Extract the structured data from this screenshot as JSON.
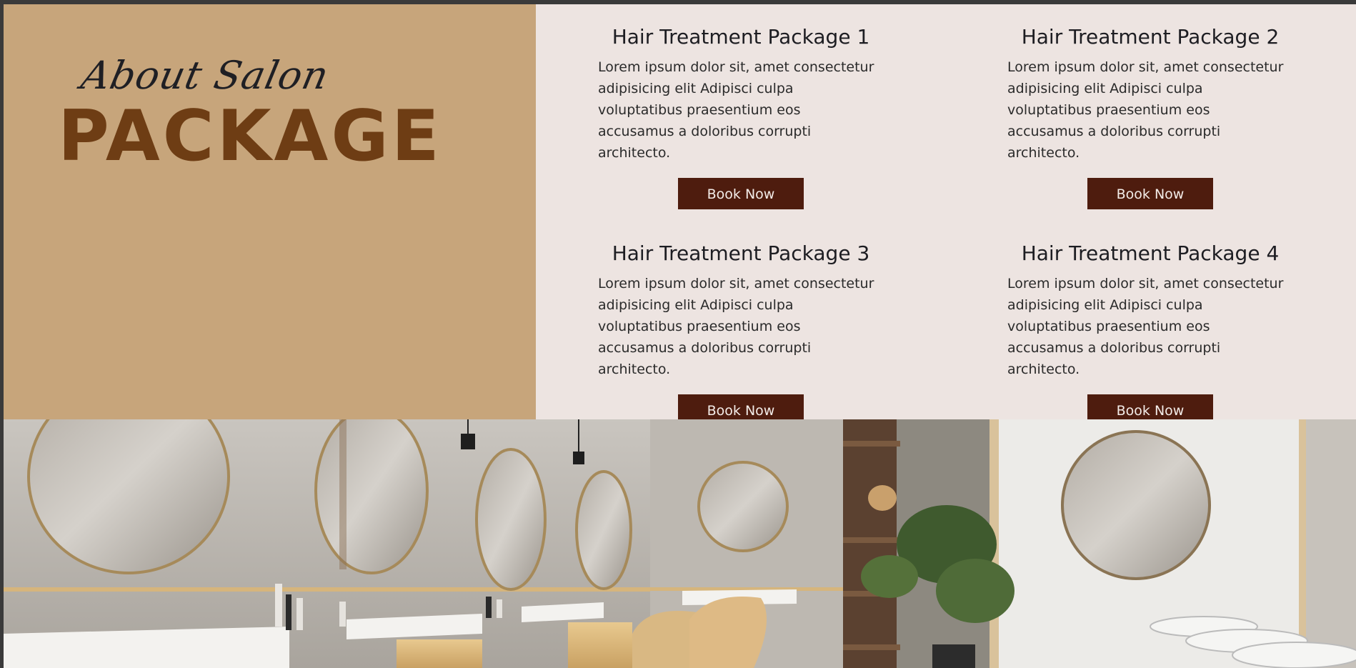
{
  "intro": {
    "script_heading": "About Salon",
    "main_heading": "PACKAGE"
  },
  "packages": [
    {
      "title": "Hair Treatment Package 1",
      "description": "Lorem ipsum dolor sit, amet consectetur adipisicing elit Adipisci culpa voluptatibus praesentium eos accusamus a doloribus corrupti architecto.",
      "button": "Book Now"
    },
    {
      "title": "Hair Treatment Package 2",
      "description": "Lorem ipsum dolor sit, amet consectetur adipisicing elit Adipisci culpa voluptatibus praesentium eos accusamus a doloribus corrupti architecto.",
      "button": "Book Now"
    },
    {
      "title": "Hair Treatment Package 3",
      "description": "Lorem ipsum dolor sit, amet consectetur adipisicing elit Adipisci culpa voluptatibus praesentium eos accusamus a doloribus corrupti architecto.",
      "button": "Book Now"
    },
    {
      "title": "Hair Treatment Package 4",
      "description": "Lorem ipsum dolor sit, amet consectetur adipisicing elit Adipisci culpa voluptatibus praesentium eos accusamus a doloribus corrupti architecto.",
      "button": "Book Now"
    }
  ],
  "colors": {
    "tan_panel": "#c7a57b",
    "heading_brown": "#6e3d14",
    "button_brown": "#4e1c0e",
    "cream_background": "#ede4e1"
  }
}
